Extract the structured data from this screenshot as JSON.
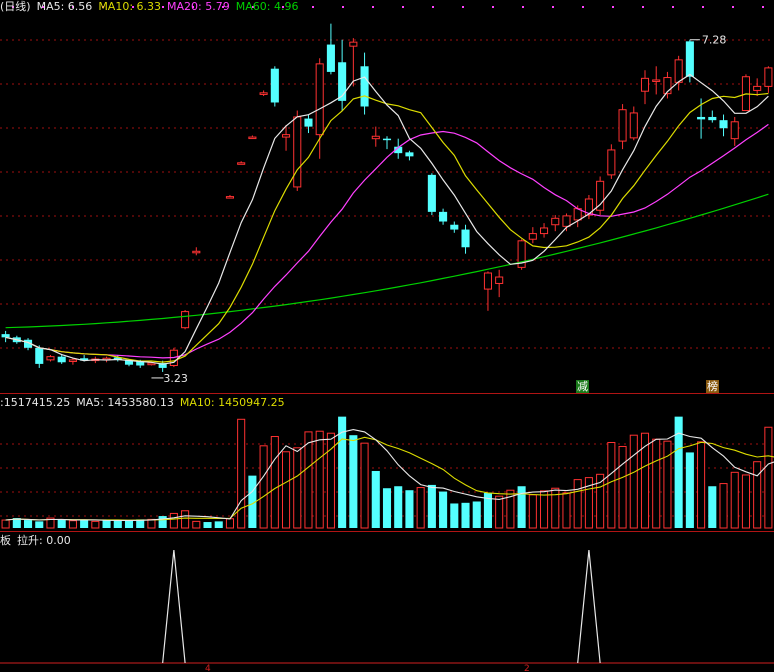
{
  "colors": {
    "up": "#ff3232",
    "down": "#54ffff",
    "ma5": "#e8e8e8",
    "ma10": "#dcdc00",
    "ma20": "#ff40ff",
    "ma60": "#00d000",
    "grid": "#a01010",
    "text": "#e8e8e8"
  },
  "price_panel": {
    "legend_prefix": "(日线)",
    "ma5_label": "MA5: 6.56",
    "ma10_label": "MA10: 6.33",
    "ma20_label": "MA20: 5.79",
    "ma60_label": "MA60: 4.96",
    "high_marker": "7.28",
    "low_marker": "3.23",
    "signal_tag_1": "减",
    "signal_tag_2": "榜"
  },
  "volume_panel": {
    "vol_label": ":1517415.25",
    "ma5_label": "MA5: 1453580.13",
    "ma10_label": "MA10: 1450947.25"
  },
  "indicator_panel": {
    "prefix": "板",
    "label": "拉升: 0.00",
    "axis_mark_1": "4",
    "axis_mark_2": "2"
  },
  "chart_data": {
    "type": "candlestick",
    "ohlc": [
      [
        3.62,
        3.66,
        3.52,
        3.58
      ],
      [
        3.58,
        3.6,
        3.5,
        3.52
      ],
      [
        3.55,
        3.57,
        3.42,
        3.45
      ],
      [
        3.45,
        3.48,
        3.2,
        3.25
      ],
      [
        3.3,
        3.36,
        3.28,
        3.34
      ],
      [
        3.34,
        3.36,
        3.25,
        3.27
      ],
      [
        3.28,
        3.32,
        3.24,
        3.3
      ],
      [
        3.32,
        3.36,
        3.28,
        3.29
      ],
      [
        3.3,
        3.34,
        3.26,
        3.31
      ],
      [
        3.31,
        3.34,
        3.27,
        3.32
      ],
      [
        3.33,
        3.36,
        3.28,
        3.3
      ],
      [
        3.3,
        3.31,
        3.22,
        3.24
      ],
      [
        3.28,
        3.3,
        3.2,
        3.23
      ],
      [
        3.24,
        3.27,
        3.23,
        3.26
      ],
      [
        3.26,
        3.29,
        3.15,
        3.2
      ],
      [
        3.23,
        3.45,
        3.21,
        3.42
      ],
      [
        3.7,
        3.92,
        3.68,
        3.9
      ],
      [
        4.65,
        4.7,
        4.6,
        4.65
      ],
      [
        null,
        null,
        null,
        null
      ],
      [
        null,
        null,
        null,
        null
      ],
      [
        5.33,
        5.35,
        5.31,
        5.33
      ],
      [
        5.75,
        5.77,
        5.73,
        5.75
      ],
      [
        6.07,
        6.09,
        6.05,
        6.07
      ],
      [
        6.6,
        6.65,
        6.58,
        6.62
      ],
      [
        6.92,
        6.95,
        6.45,
        6.5
      ],
      [
        6.07,
        6.22,
        5.9,
        6.1
      ],
      [
        5.45,
        6.4,
        5.4,
        6.32
      ],
      [
        6.3,
        6.35,
        6.12,
        6.2
      ],
      [
        6.1,
        7.05,
        5.8,
        6.98
      ],
      [
        7.22,
        7.48,
        6.85,
        6.88
      ],
      [
        7.0,
        7.28,
        6.4,
        6.52
      ],
      [
        7.2,
        7.3,
        6.7,
        7.25
      ],
      [
        6.95,
        7.12,
        6.35,
        6.45
      ],
      [
        6.05,
        6.2,
        5.95,
        6.08
      ],
      [
        6.05,
        6.08,
        5.92,
        6.04
      ],
      [
        5.95,
        6.05,
        5.8,
        5.87
      ],
      [
        5.88,
        5.9,
        5.78,
        5.83
      ],
      [
        null,
        null,
        null,
        null
      ],
      [
        5.6,
        5.62,
        5.1,
        5.14
      ],
      [
        5.14,
        5.18,
        4.98,
        5.02
      ],
      [
        4.98,
        5.02,
        4.88,
        4.92
      ],
      [
        4.92,
        4.98,
        4.62,
        4.7
      ],
      [
        null,
        null,
        null,
        null
      ],
      [
        4.18,
        4.4,
        3.91,
        4.38
      ],
      [
        4.25,
        4.42,
        4.08,
        4.33
      ],
      [
        null,
        null,
        null,
        null
      ],
      [
        4.45,
        4.8,
        4.42,
        4.78
      ],
      [
        4.8,
        4.95,
        4.75,
        4.87
      ],
      [
        4.87,
        5.0,
        4.82,
        4.94
      ],
      [
        4.98,
        5.1,
        4.9,
        5.06
      ],
      [
        4.96,
        5.12,
        4.9,
        5.09
      ],
      [
        5.04,
        5.22,
        4.95,
        5.18
      ],
      [
        5.1,
        5.35,
        5.05,
        5.3
      ],
      [
        5.16,
        5.58,
        5.1,
        5.52
      ],
      [
        5.6,
        5.98,
        5.55,
        5.91
      ],
      [
        6.02,
        6.48,
        5.92,
        6.41
      ],
      [
        6.06,
        6.45,
        6.03,
        6.37
      ],
      [
        6.64,
        6.9,
        6.48,
        6.8
      ],
      [
        6.77,
        6.95,
        6.6,
        6.78
      ],
      [
        6.61,
        6.88,
        6.55,
        6.81
      ],
      [
        6.75,
        7.08,
        6.65,
        7.03
      ],
      [
        7.26,
        7.28,
        6.75,
        6.82
      ],
      [
        6.32,
        6.55,
        6.05,
        6.29
      ],
      [
        6.32,
        6.4,
        6.25,
        6.28
      ],
      [
        6.28,
        6.35,
        6.08,
        6.18
      ],
      [
        6.05,
        6.32,
        5.96,
        6.26
      ],
      [
        6.4,
        6.85,
        6.4,
        6.82
      ],
      [
        6.65,
        6.8,
        6.58,
        6.7
      ],
      [
        6.7,
        6.95,
        6.62,
        6.93
      ]
    ],
    "volume_bars": [
      [
        0.12,
        "up"
      ],
      [
        0.15,
        "down"
      ],
      [
        0.12,
        "down"
      ],
      [
        0.1,
        "down"
      ],
      [
        0.15,
        "up"
      ],
      [
        0.13,
        "down"
      ],
      [
        0.11,
        "up"
      ],
      [
        0.12,
        "down"
      ],
      [
        0.1,
        "up"
      ],
      [
        0.12,
        "down"
      ],
      [
        0.12,
        "down"
      ],
      [
        0.11,
        "down"
      ],
      [
        0.13,
        "down"
      ],
      [
        0.13,
        "up"
      ],
      [
        0.18,
        "down"
      ],
      [
        0.22,
        "up"
      ],
      [
        0.26,
        "up"
      ],
      [
        0.1,
        "up"
      ],
      [
        0.09,
        "down"
      ],
      [
        0.1,
        "down"
      ],
      [
        0.14,
        "up"
      ],
      [
        1.64,
        "up"
      ],
      [
        0.79,
        "down"
      ],
      [
        1.24,
        "up"
      ],
      [
        1.38,
        "up"
      ],
      [
        1.15,
        "up"
      ],
      [
        1.21,
        "up"
      ],
      [
        1.45,
        "up"
      ],
      [
        1.46,
        "up"
      ],
      [
        1.43,
        "up"
      ],
      [
        1.68,
        "down"
      ],
      [
        1.4,
        "down"
      ],
      [
        1.28,
        "up"
      ],
      [
        0.86,
        "down"
      ],
      [
        0.6,
        "down"
      ],
      [
        0.63,
        "down"
      ],
      [
        0.57,
        "down"
      ],
      [
        0.61,
        "up"
      ],
      [
        0.65,
        "down"
      ],
      [
        0.55,
        "down"
      ],
      [
        0.37,
        "down"
      ],
      [
        0.38,
        "down"
      ],
      [
        0.4,
        "down"
      ],
      [
        0.53,
        "down"
      ],
      [
        0.48,
        "up"
      ],
      [
        0.57,
        "up"
      ],
      [
        0.63,
        "down"
      ],
      [
        0.5,
        "up"
      ],
      [
        0.56,
        "up"
      ],
      [
        0.6,
        "up"
      ],
      [
        0.53,
        "up"
      ],
      [
        0.73,
        "up"
      ],
      [
        0.76,
        "up"
      ],
      [
        0.81,
        "up"
      ],
      [
        1.29,
        "up"
      ],
      [
        1.23,
        "up"
      ],
      [
        1.4,
        "up"
      ],
      [
        1.43,
        "up"
      ],
      [
        1.34,
        "up"
      ],
      [
        1.31,
        "up"
      ],
      [
        1.68,
        "down"
      ],
      [
        1.14,
        "down"
      ],
      [
        1.3,
        "up"
      ],
      [
        0.63,
        "down"
      ],
      [
        0.67,
        "up"
      ],
      [
        0.84,
        "up"
      ],
      [
        0.8,
        "up"
      ],
      [
        1.0,
        "up"
      ],
      [
        1.52,
        "up"
      ],
      [
        0.97,
        "up"
      ]
    ],
    "indicator_spikes": [
      15,
      52
    ],
    "y_range": [
      3.0,
      7.6
    ]
  }
}
